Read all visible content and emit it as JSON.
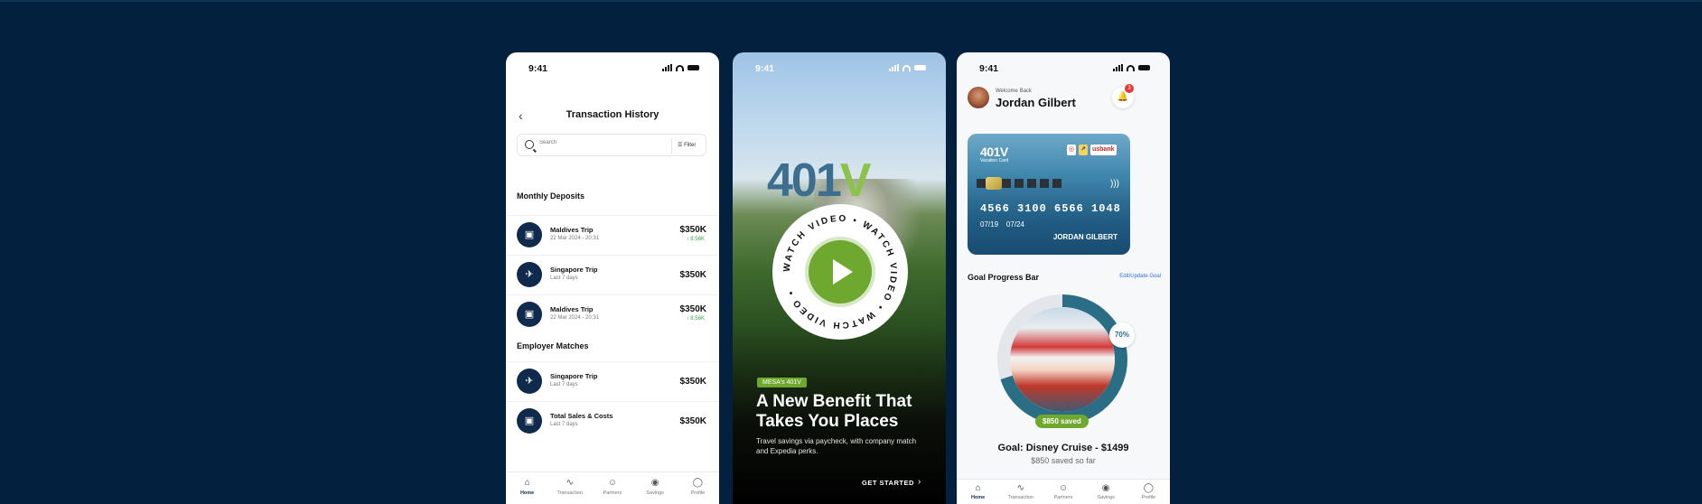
{
  "status": {
    "time": "9:41"
  },
  "phone1": {
    "title": "Transaction History",
    "back_icon": "chevron-left-icon",
    "search_placeholder": "Search",
    "filter_label": "Filter",
    "sections": [
      {
        "title": "Monthly Deposits",
        "rows": [
          {
            "name": "Maldives Trip",
            "sub": "22 Mar 2024 - 20:31",
            "amount": "$350K",
            "change": "↑ 8.56K",
            "icon": "card-icon"
          },
          {
            "name": "Singapore Trip",
            "sub": "Last 7 days",
            "amount": "$350K",
            "change": "",
            "icon": "plane-icon"
          },
          {
            "name": "Maldives Trip",
            "sub": "22 Mar 2024 - 20:31",
            "amount": "$350K",
            "change": "↑ 8.56K",
            "icon": "card-icon"
          }
        ]
      },
      {
        "title": "Employer Matches",
        "rows": [
          {
            "name": "Singapore Trip",
            "sub": "Last 7 days",
            "amount": "$350K",
            "change": "",
            "icon": "plane-icon"
          },
          {
            "name": "Total Sales & Costs",
            "sub": "Last 7 days",
            "amount": "$350K",
            "change": "",
            "icon": "card-icon"
          }
        ]
      }
    ],
    "tabs": [
      {
        "label": "Home",
        "icon": "home-icon",
        "active": true
      },
      {
        "label": "Transaction",
        "icon": "pulse-icon",
        "active": false
      },
      {
        "label": "Partners",
        "icon": "users-icon",
        "active": false
      },
      {
        "label": "Savings",
        "icon": "piggy-bank-icon",
        "active": false
      },
      {
        "label": "Profile",
        "icon": "user-icon",
        "active": false
      }
    ]
  },
  "phone2": {
    "logo_main": "401",
    "logo_accent": "V",
    "ring_text": "WATCH VIDEO • WATCH VIDEO • WATCH VIDEO • ",
    "badge": "MESA's 401V",
    "headline": "A New Benefit That Takes You Places",
    "description": "Travel savings via paycheck, with company match and Expedia perks.",
    "cta": "GET STARTED",
    "cta_icon": "chevron-right-icon"
  },
  "phone3": {
    "welcome": "Welcome Back",
    "user_name": "Jordan Gilbert",
    "notification_count": "3",
    "card": {
      "logo": "401V",
      "subtitle": "Vacation Card",
      "brand": "usbank",
      "number": "4566 3100 6566 1048",
      "valid_from": "07/19",
      "valid_thru": "07/24",
      "holder": "JORDAN GILBERT"
    },
    "goal_section_title": "Goal Progress Bar",
    "edit_link": "Edit/Update Goal",
    "progress": 0.7,
    "progress_label": "70%",
    "saved_badge": "$850 saved",
    "goal_title": "Goal: Disney Cruise - $1499",
    "goal_sub": "$850 saved so far",
    "tabs": [
      {
        "label": "Home",
        "icon": "home-icon",
        "active": true
      },
      {
        "label": "Transaction",
        "icon": "pulse-icon",
        "active": false
      },
      {
        "label": "Partners",
        "icon": "users-icon",
        "active": false
      },
      {
        "label": "Savings",
        "icon": "piggy-bank-icon",
        "active": false
      },
      {
        "label": "Profile",
        "icon": "user-icon",
        "active": false
      }
    ]
  },
  "colors": {
    "navy": "#03213f",
    "accent_green": "#6ea82e",
    "teal": "#2a6e86"
  }
}
